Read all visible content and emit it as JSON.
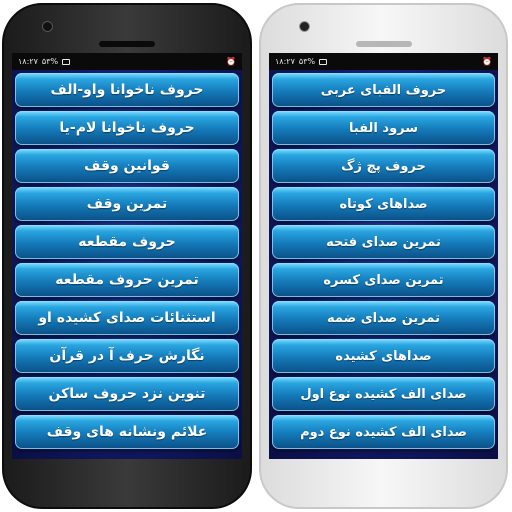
{
  "left_phone": {
    "status": {
      "time": "۱۸:۲۷",
      "battery": "۵۳%"
    },
    "items": [
      "حروف ناخوانا واو-الف",
      "حروف ناخوانا لام-یا",
      "قوانین وقف",
      "تمرین وقف",
      "حروف مقطعه",
      "تمرین حروف مقطعه",
      "استثنائات صدای کشیده او",
      "نگارش حرف آ در قرآن",
      "تنوین نزد حروف ساکن",
      "علائم ونشانه های وقف"
    ]
  },
  "right_phone": {
    "status": {
      "time": "۱۸:۲۷",
      "battery": "۵۳%"
    },
    "items": [
      "حروف الفبای عربی",
      "سرود الفبا",
      "حروف پچ ژگ",
      "صداهای کوتاه",
      "تمرین صدای فتحه",
      "تمرین صدای کسره",
      "تمرین صدای ضمه",
      "صداهای کشیده",
      "صدای الف کشیده نوع اول",
      "صدای الف کشیده نوع دوم"
    ]
  },
  "icons": [
    "camera-icon",
    "speaker-grille",
    "alarm-icon",
    "battery-icon",
    "signal-icon"
  ],
  "colors": {
    "button_top": "#29a5e0",
    "button_bottom": "#0b4f86",
    "screen_bg": "#121a66",
    "status_bg": "#0a0a0a"
  }
}
